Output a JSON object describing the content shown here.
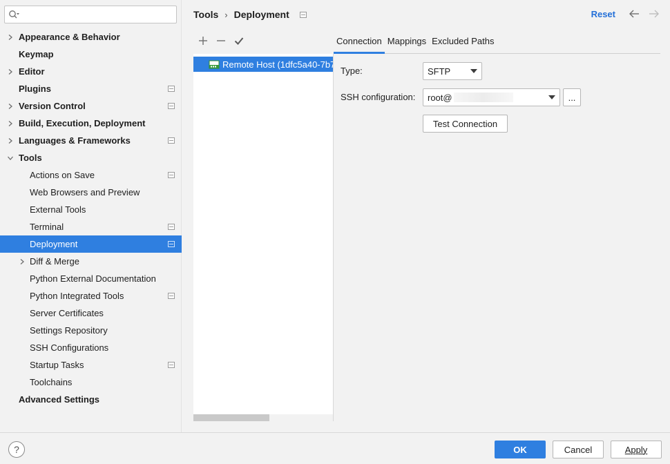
{
  "sidebar": {
    "search_placeholder": "",
    "items": [
      {
        "label": "Appearance & Behavior",
        "level": 0,
        "bold": true,
        "chevron": "right",
        "proj": false
      },
      {
        "label": "Keymap",
        "level": 0,
        "bold": true,
        "chevron": "",
        "proj": false
      },
      {
        "label": "Editor",
        "level": 0,
        "bold": true,
        "chevron": "right",
        "proj": false
      },
      {
        "label": "Plugins",
        "level": 0,
        "bold": true,
        "chevron": "",
        "proj": true
      },
      {
        "label": "Version Control",
        "level": 0,
        "bold": true,
        "chevron": "right",
        "proj": true
      },
      {
        "label": "Build, Execution, Deployment",
        "level": 0,
        "bold": true,
        "chevron": "right",
        "proj": false
      },
      {
        "label": "Languages & Frameworks",
        "level": 0,
        "bold": true,
        "chevron": "right",
        "proj": true
      },
      {
        "label": "Tools",
        "level": 0,
        "bold": true,
        "chevron": "down",
        "proj": false
      },
      {
        "label": "Actions on Save",
        "level": 1,
        "bold": false,
        "chevron": "",
        "proj": true
      },
      {
        "label": "Web Browsers and Preview",
        "level": 1,
        "bold": false,
        "chevron": "",
        "proj": false
      },
      {
        "label": "External Tools",
        "level": 1,
        "bold": false,
        "chevron": "",
        "proj": false
      },
      {
        "label": "Terminal",
        "level": 1,
        "bold": false,
        "chevron": "",
        "proj": true
      },
      {
        "label": "Deployment",
        "level": 1,
        "bold": false,
        "chevron": "",
        "proj": true,
        "selected": true
      },
      {
        "label": "Diff & Merge",
        "level": 1,
        "bold": false,
        "chevron": "right",
        "proj": false
      },
      {
        "label": "Python External Documentation",
        "level": 1,
        "bold": false,
        "chevron": "",
        "proj": false
      },
      {
        "label": "Python Integrated Tools",
        "level": 1,
        "bold": false,
        "chevron": "",
        "proj": true
      },
      {
        "label": "Server Certificates",
        "level": 1,
        "bold": false,
        "chevron": "",
        "proj": false
      },
      {
        "label": "Settings Repository",
        "level": 1,
        "bold": false,
        "chevron": "",
        "proj": false
      },
      {
        "label": "SSH Configurations",
        "level": 1,
        "bold": false,
        "chevron": "",
        "proj": false
      },
      {
        "label": "Startup Tasks",
        "level": 1,
        "bold": false,
        "chevron": "",
        "proj": true
      },
      {
        "label": "Toolchains",
        "level": 1,
        "bold": false,
        "chevron": "",
        "proj": false
      },
      {
        "label": "Advanced Settings",
        "level": 0,
        "bold": true,
        "chevron": "",
        "proj": false
      }
    ]
  },
  "header": {
    "crumb_parent": "Tools",
    "crumb_sep": "›",
    "crumb_current": "Deployment",
    "reset_label": "Reset"
  },
  "hosts": {
    "items": [
      {
        "label": "Remote Host (1dfc5a40-7b7"
      }
    ]
  },
  "tabs": [
    {
      "label": "Connection",
      "active": true
    },
    {
      "label": "Mappings",
      "active": false
    },
    {
      "label": "Excluded Paths",
      "active": false
    }
  ],
  "form": {
    "type_label": "Type:",
    "type_value": "SFTP",
    "ssh_label": "SSH configuration:",
    "ssh_value": "root@",
    "browse_label": "...",
    "test_label": "Test Connection"
  },
  "footer": {
    "help_label": "?",
    "ok_label": "OK",
    "cancel_label": "Cancel",
    "apply_label": "Apply"
  },
  "colors": {
    "accent": "#2f7fe0",
    "link": "#2470d8"
  }
}
